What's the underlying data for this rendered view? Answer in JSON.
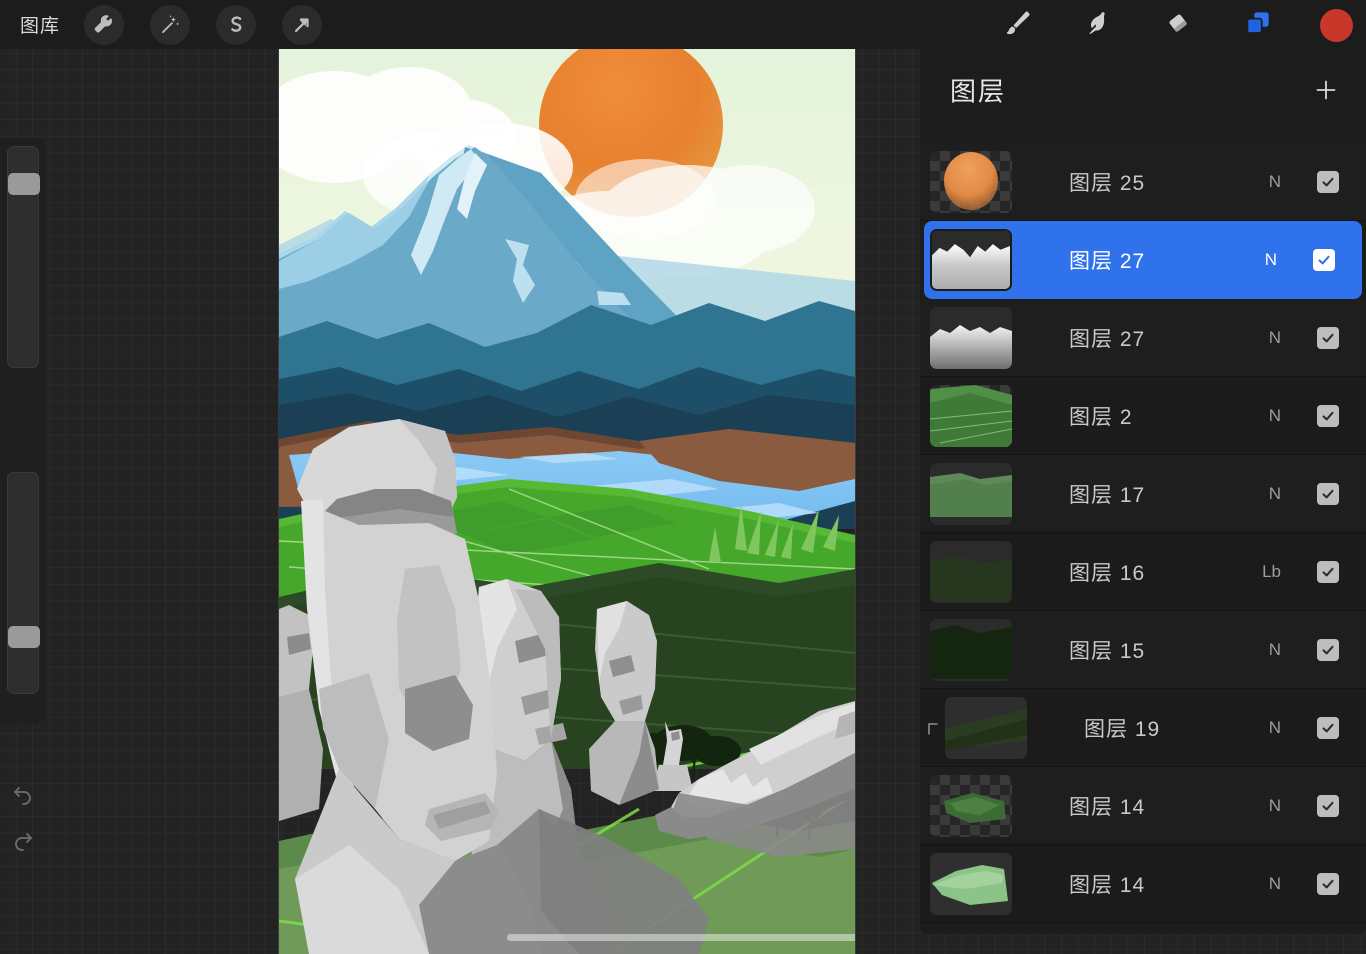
{
  "app": {
    "name": "Procreate",
    "background_color": "#232323",
    "panel_color": "#1c1c1c",
    "accent_color": "#2f72ec"
  },
  "topbar": {
    "gallery_label": "图库",
    "left_tools": [
      {
        "name": "actions-wrench",
        "icon": "wrench-icon"
      },
      {
        "name": "adjustments-wand",
        "icon": "magic-wand-icon"
      },
      {
        "name": "selection-s",
        "icon": "selection-icon"
      },
      {
        "name": "transform-arrow",
        "icon": "arrow-icon"
      }
    ],
    "right_tools": [
      {
        "name": "paint-brush",
        "icon": "brush-icon"
      },
      {
        "name": "smudge",
        "icon": "smudge-icon"
      },
      {
        "name": "eraser",
        "icon": "eraser-icon"
      },
      {
        "name": "layers",
        "icon": "layers-icon",
        "active": true
      }
    ],
    "color_swatch": "#c8372a"
  },
  "sidebar": {
    "brush_size_percent": 88,
    "brush_opacity_percent": 31,
    "modify_button": "square-button",
    "undo_label": "undo-icon",
    "redo_label": "redo-icon"
  },
  "layers_panel": {
    "title": "图层",
    "add_button": "plus-icon",
    "layers": [
      {
        "name": "图层 25",
        "blend": "N",
        "visible": true,
        "selected": false,
        "clipped": false,
        "thumb": "sun"
      },
      {
        "name": "图层 27",
        "blend": "N",
        "visible": true,
        "selected": true,
        "clipped": false,
        "thumb": "clouds-bright"
      },
      {
        "name": "图层 27",
        "blend": "N",
        "visible": true,
        "selected": false,
        "clipped": false,
        "thumb": "clouds-soft"
      },
      {
        "name": "图层 2",
        "blend": "N",
        "visible": true,
        "selected": false,
        "clipped": false,
        "thumb": "green-streaks"
      },
      {
        "name": "图层 17",
        "blend": "N",
        "visible": true,
        "selected": false,
        "clipped": false,
        "thumb": "green-field"
      },
      {
        "name": "图层 16",
        "blend": "Lb",
        "visible": true,
        "selected": false,
        "clipped": false,
        "thumb": "dark-field"
      },
      {
        "name": "图层 15",
        "blend": "N",
        "visible": true,
        "selected": false,
        "clipped": false,
        "thumb": "darker-field"
      },
      {
        "name": "图层 19",
        "blend": "N",
        "visible": true,
        "selected": false,
        "clipped": true,
        "thumb": "diag-dark"
      },
      {
        "name": "图层 14",
        "blend": "N",
        "visible": true,
        "selected": false,
        "clipped": false,
        "thumb": "leaf-alpha"
      },
      {
        "name": "图层 14",
        "blend": "N",
        "visible": true,
        "selected": false,
        "clipped": false,
        "thumb": "leaf-light"
      }
    ]
  },
  "canvas": {
    "artwork_title": "Easter Island Moai Landscape",
    "scroll_indicator_visible": true,
    "palette": {
      "sky_top": "#e8f5e0",
      "sky_bottom": "#f7f4dd",
      "sun": "#e8812f",
      "cloud": "#ffffff",
      "mountain_snow": "#bfe0ef",
      "mountain_mid": "#5fa3c4",
      "mountain_dark": "#2f7491",
      "hill_deep": "#1d5068",
      "hill_deepest": "#1b4055",
      "earth": "#8b5b3f",
      "earth_dark": "#6e4733",
      "lake": "#73bdf0",
      "lake_light": "#a6d6f7",
      "grass_bright": "#56b833",
      "grass_mid": "#3f9b2c",
      "grass_dark": "#2c4a25",
      "grass_darkest": "#1e3a1c",
      "stone_light": "#d8d8d8",
      "stone_mid": "#b2b2b2",
      "stone_shadow": "#7c7c7c",
      "stone_dark": "#6a6a6a"
    }
  }
}
